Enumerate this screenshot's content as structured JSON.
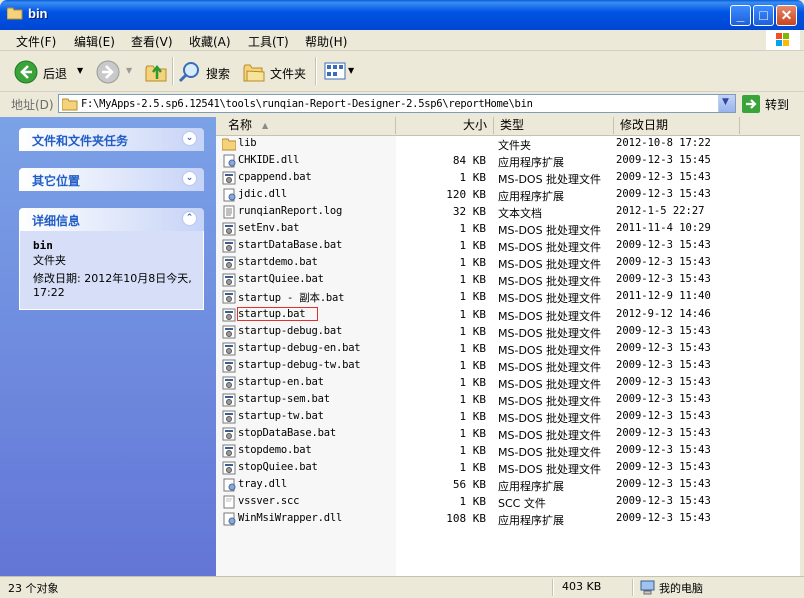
{
  "window": {
    "title": "bin"
  },
  "menu": [
    "文件(F)",
    "编辑(E)",
    "查看(V)",
    "收藏(A)",
    "工具(T)",
    "帮助(H)"
  ],
  "toolbar": {
    "back_label": "后退",
    "search_label": "搜索",
    "folders_label": "文件夹"
  },
  "address": {
    "label": "地址(D)",
    "path": "F:\\MyApps-2.5.sp6.12541\\tools\\runqian-Report-Designer-2.5sp6\\reportHome\\bin",
    "go_label": "转到"
  },
  "left_pane": {
    "tasks_title": "文件和文件夹任务",
    "other_title": "其它位置",
    "details_title": "详细信息",
    "details": {
      "name": "bin",
      "type": "文件夹",
      "modified": "修改日期: 2012年10月8日今天, 17:22"
    }
  },
  "columns": {
    "name": "名称",
    "size": "大小",
    "type": "类型",
    "modified": "修改日期"
  },
  "files": [
    {
      "name": "lib",
      "size": "",
      "type": "文件夹",
      "date": "2012-10-8 17:22",
      "icon": "folder-icon"
    },
    {
      "name": "CHKIDE.dll",
      "size": "84 KB",
      "type": "应用程序扩展",
      "date": "2009-12-3 15:45",
      "icon": "dll-icon"
    },
    {
      "name": "cpappend.bat",
      "size": "1 KB",
      "type": "MS-DOS 批处理文件",
      "date": "2009-12-3 15:43",
      "icon": "bat-icon"
    },
    {
      "name": "jdic.dll",
      "size": "120 KB",
      "type": "应用程序扩展",
      "date": "2009-12-3 15:43",
      "icon": "dll-icon"
    },
    {
      "name": "runqianReport.log",
      "size": "32 KB",
      "type": "文本文档",
      "date": "2012-1-5 22:27",
      "icon": "text-icon"
    },
    {
      "name": "setEnv.bat",
      "size": "1 KB",
      "type": "MS-DOS 批处理文件",
      "date": "2011-11-4 10:29",
      "icon": "bat-icon"
    },
    {
      "name": "startDataBase.bat",
      "size": "1 KB",
      "type": "MS-DOS 批处理文件",
      "date": "2009-12-3 15:43",
      "icon": "bat-icon"
    },
    {
      "name": "startdemo.bat",
      "size": "1 KB",
      "type": "MS-DOS 批处理文件",
      "date": "2009-12-3 15:43",
      "icon": "bat-icon"
    },
    {
      "name": "startQuiee.bat",
      "size": "1 KB",
      "type": "MS-DOS 批处理文件",
      "date": "2009-12-3 15:43",
      "icon": "bat-icon"
    },
    {
      "name": "startup - 副本.bat",
      "size": "1 KB",
      "type": "MS-DOS 批处理文件",
      "date": "2011-12-9 11:40",
      "icon": "bat-icon"
    },
    {
      "name": "startup.bat",
      "size": "1 KB",
      "type": "MS-DOS 批处理文件",
      "date": "2012-9-12 14:46",
      "icon": "bat-icon",
      "highlight": true
    },
    {
      "name": "startup-debug.bat",
      "size": "1 KB",
      "type": "MS-DOS 批处理文件",
      "date": "2009-12-3 15:43",
      "icon": "bat-icon"
    },
    {
      "name": "startup-debug-en.bat",
      "size": "1 KB",
      "type": "MS-DOS 批处理文件",
      "date": "2009-12-3 15:43",
      "icon": "bat-icon"
    },
    {
      "name": "startup-debug-tw.bat",
      "size": "1 KB",
      "type": "MS-DOS 批处理文件",
      "date": "2009-12-3 15:43",
      "icon": "bat-icon"
    },
    {
      "name": "startup-en.bat",
      "size": "1 KB",
      "type": "MS-DOS 批处理文件",
      "date": "2009-12-3 15:43",
      "icon": "bat-icon"
    },
    {
      "name": "startup-sem.bat",
      "size": "1 KB",
      "type": "MS-DOS 批处理文件",
      "date": "2009-12-3 15:43",
      "icon": "bat-icon"
    },
    {
      "name": "startup-tw.bat",
      "size": "1 KB",
      "type": "MS-DOS 批处理文件",
      "date": "2009-12-3 15:43",
      "icon": "bat-icon"
    },
    {
      "name": "stopDataBase.bat",
      "size": "1 KB",
      "type": "MS-DOS 批处理文件",
      "date": "2009-12-3 15:43",
      "icon": "bat-icon"
    },
    {
      "name": "stopdemo.bat",
      "size": "1 KB",
      "type": "MS-DOS 批处理文件",
      "date": "2009-12-3 15:43",
      "icon": "bat-icon"
    },
    {
      "name": "stopQuiee.bat",
      "size": "1 KB",
      "type": "MS-DOS 批处理文件",
      "date": "2009-12-3 15:43",
      "icon": "bat-icon"
    },
    {
      "name": "tray.dll",
      "size": "56 KB",
      "type": "应用程序扩展",
      "date": "2009-12-3 15:43",
      "icon": "dll-icon"
    },
    {
      "name": "vssver.scc",
      "size": "1 KB",
      "type": "SCC 文件",
      "date": "2009-12-3 15:43",
      "icon": "generic-file-icon"
    },
    {
      "name": "WinMsiWrapper.dll",
      "size": "108 KB",
      "type": "应用程序扩展",
      "date": "2009-12-3 15:43",
      "icon": "dll-icon"
    }
  ],
  "status": {
    "count": "23 个对象",
    "size": "403 KB",
    "location": "我的电脑"
  }
}
